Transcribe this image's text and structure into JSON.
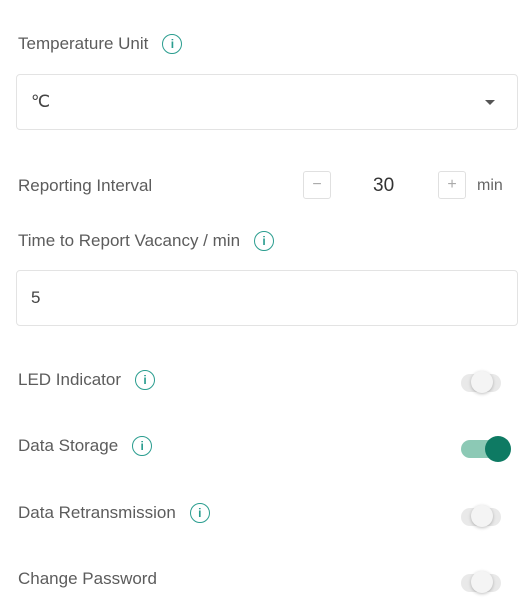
{
  "temperature_unit": {
    "label": "Temperature Unit",
    "info_icon": "info-icon",
    "selected": "℃"
  },
  "reporting_interval": {
    "label": "Reporting Interval",
    "decrement": "−",
    "value": "30",
    "increment": "+",
    "unit": "min"
  },
  "vacancy": {
    "label": "Time to Report Vacancy / min",
    "info_icon": "info-icon",
    "value": "5"
  },
  "toggles": [
    {
      "label": "LED Indicator",
      "info_icon": "info-icon",
      "state": "off"
    },
    {
      "label": "Data Storage",
      "info_icon": "info-icon",
      "state": "on"
    },
    {
      "label": "Data Retransmission",
      "info_icon": "info-icon",
      "state": "off"
    },
    {
      "label": "Change Password",
      "state": "off"
    }
  ],
  "info_glyph": "i",
  "colors": {
    "accent": "#0e7a63",
    "accent_track": "#8cc9b5",
    "info": "#2a9d8f"
  }
}
